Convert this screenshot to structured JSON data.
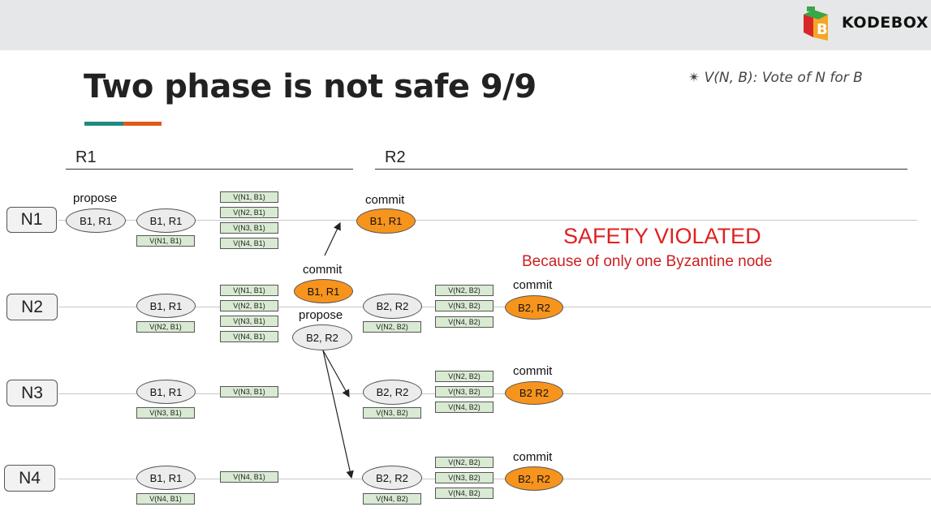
{
  "brand": {
    "name": "KODEBOX",
    "colors": {
      "red": "#d9262b",
      "green": "#3aa64a",
      "orange": "#f5a623"
    }
  },
  "title": "Two phase is not safe 9/9",
  "legend": "✴ V(N, B): Vote of N for B",
  "rounds": {
    "r1": "R1",
    "r2": "R2"
  },
  "nodes": {
    "n1": "N1",
    "n2": "N2",
    "n3": "N3",
    "n4": "N4"
  },
  "labels": {
    "propose": "propose",
    "commit": "commit",
    "safety": "SAFETY VIOLATED",
    "because": "Because of only one Byzantine node"
  },
  "blocks": {
    "b1r1": "B1, R1",
    "b2r2": "B2, R2",
    "b2r2_nocomma": "B2 R2"
  },
  "votes": {
    "n1b1": "V(N1, B1)",
    "n2b1": "V(N2, B1)",
    "n3b1": "V(N3, B1)",
    "n4b1": "V(N4, B1)",
    "n2b2": "V(N2, B2)",
    "n3b2": "V(N3, B2)",
    "n4b2": "V(N4, B2)"
  },
  "colors": {
    "commit_fill": "#f7941d",
    "vote_fill": "#d9ead3",
    "alert": "#e02020"
  }
}
